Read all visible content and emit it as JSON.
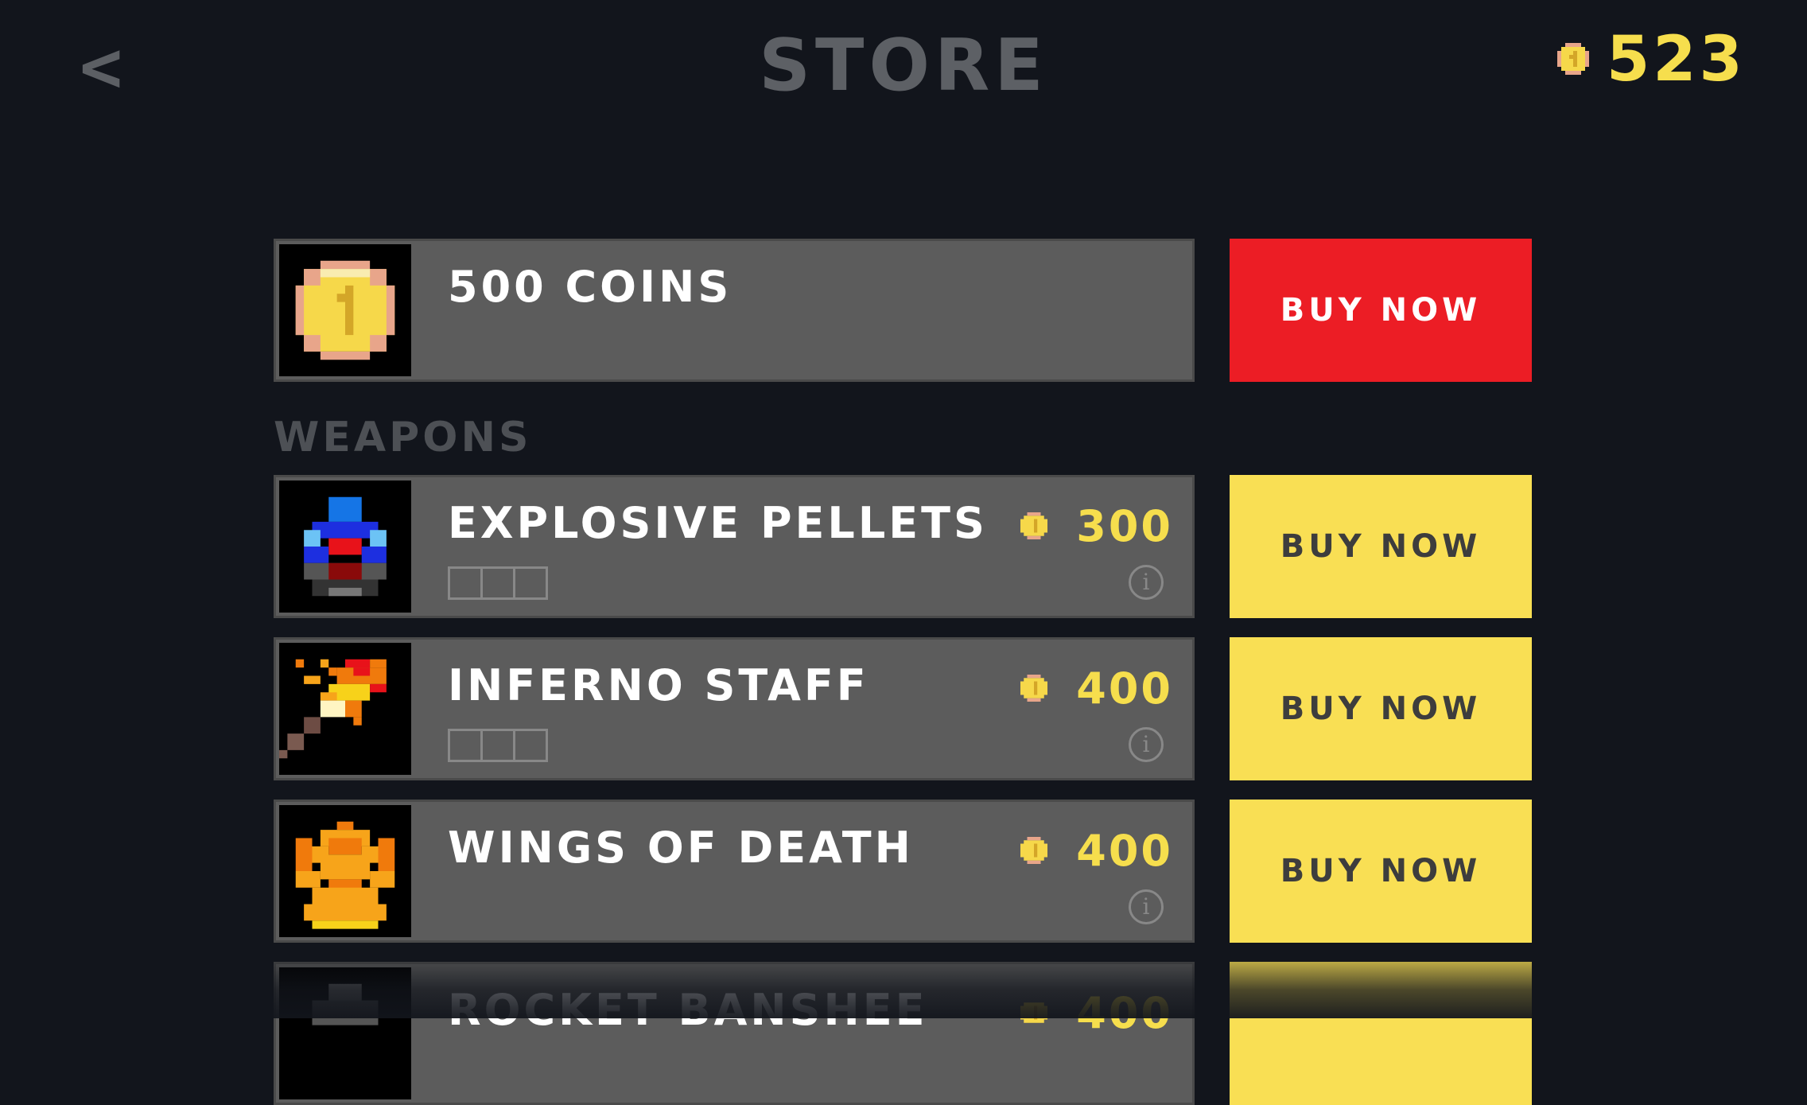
{
  "header": {
    "back_label": "<",
    "title": "STORE",
    "coin_balance": "523"
  },
  "featured": {
    "name": "500 COINS",
    "buy_label": "BUY NOW",
    "icon": "gold-coin-icon"
  },
  "sections": [
    {
      "label": "WEAPONS",
      "items": [
        {
          "name": "EXPLOSIVE PELLETS",
          "price": "300",
          "buy_label": "BUY NOW",
          "upgrade_slots": 3,
          "icon": "explosive-pellets-icon"
        },
        {
          "name": "INFERNO STAFF",
          "price": "400",
          "buy_label": "BUY NOW",
          "upgrade_slots": 3,
          "icon": "inferno-staff-icon"
        },
        {
          "name": "WINGS OF DEATH",
          "price": "400",
          "buy_label": "BUY NOW",
          "upgrade_slots": 0,
          "icon": "wings-of-death-icon"
        },
        {
          "name": "ROCKET BANSHEE",
          "price": "400",
          "buy_label": "",
          "upgrade_slots": 0,
          "icon": "rocket-banshee-icon"
        }
      ]
    }
  ],
  "colors": {
    "background": "#12151c",
    "card": "#5c5c5c",
    "coin_yellow": "#f6de4d",
    "buy_red": "#ec1d25",
    "buy_yellow": "#f9df54"
  }
}
